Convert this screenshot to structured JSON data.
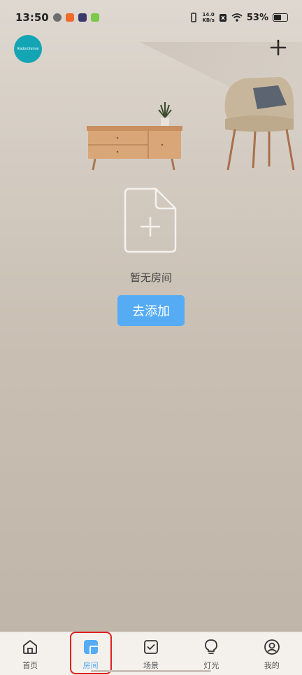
{
  "status": {
    "time": "13:50",
    "net_speed_value": "14.0",
    "net_speed_unit": "KB/s",
    "battery_percent": "53%"
  },
  "header": {
    "logo_text": "RadonSense"
  },
  "empty_state": {
    "message": "暂无房间",
    "add_button": "去添加"
  },
  "tabs": [
    {
      "label": "首页",
      "icon": "home-icon",
      "active": false
    },
    {
      "label": "房间",
      "icon": "room-icon",
      "active": true
    },
    {
      "label": "场景",
      "icon": "scene-check-icon",
      "active": false
    },
    {
      "label": "灯光",
      "icon": "bulb-icon",
      "active": false
    },
    {
      "label": "我的",
      "icon": "profile-icon",
      "active": false
    }
  ],
  "colors": {
    "accent": "#55acf5",
    "logo_bg": "#14a5b5",
    "highlight": "#e02020"
  }
}
